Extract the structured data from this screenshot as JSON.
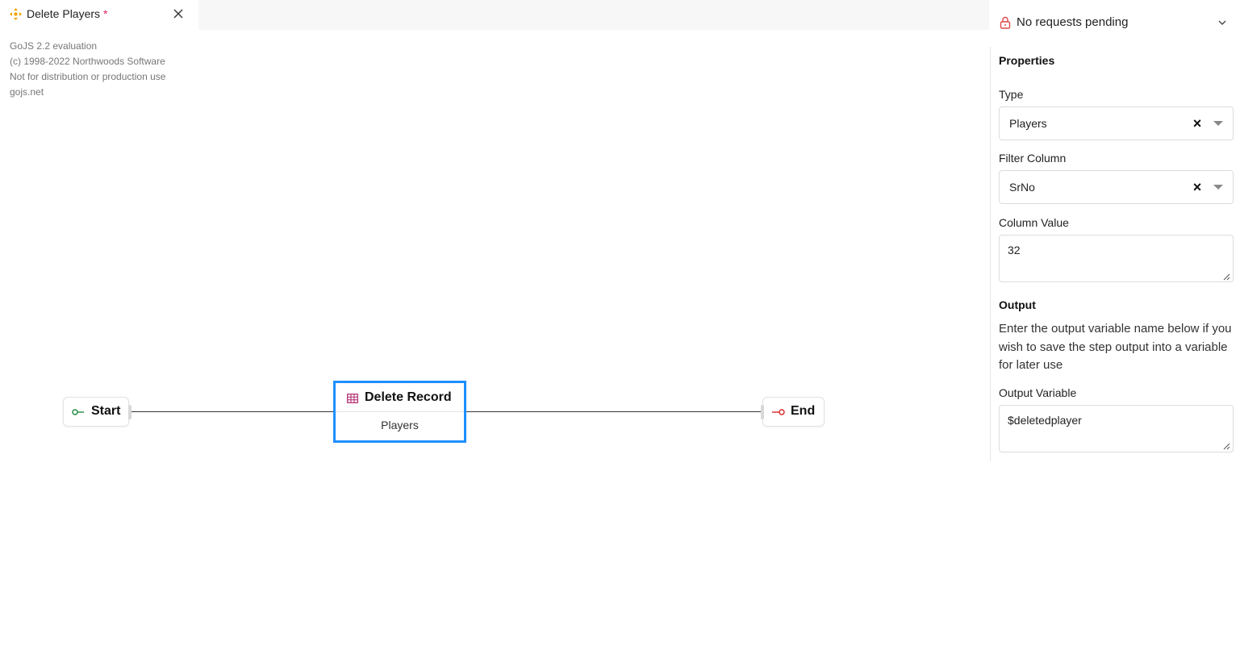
{
  "tab": {
    "title": "Delete Players",
    "dirty_marker": "*"
  },
  "watermark": {
    "lines": [
      "GoJS 2.2 evaluation",
      "(c) 1998-2022 Northwoods Software",
      "Not for distribution or production use",
      "gojs.net"
    ]
  },
  "diagram": {
    "start_label": "Start",
    "end_label": "End",
    "main_title": "Delete Record",
    "main_subtitle": "Players"
  },
  "panel": {
    "requests_status": "No requests pending",
    "properties_title": "Properties",
    "type_label": "Type",
    "type_value": "Players",
    "filter_label": "Filter Column",
    "filter_value": "SrNo",
    "column_value_label": "Column Value",
    "column_value": "32",
    "output_title": "Output",
    "output_desc": "Enter the output variable name below if you wish to save the step output into a variable for later use",
    "output_var_label": "Output Variable",
    "output_var_value": "$deletedplayer"
  },
  "colors": {
    "selection": "#1e90ff",
    "start_icon": "#1e8a3c",
    "end_icon": "#d62828",
    "table_icon": "#b0246b",
    "dirty": "#e0245e"
  }
}
